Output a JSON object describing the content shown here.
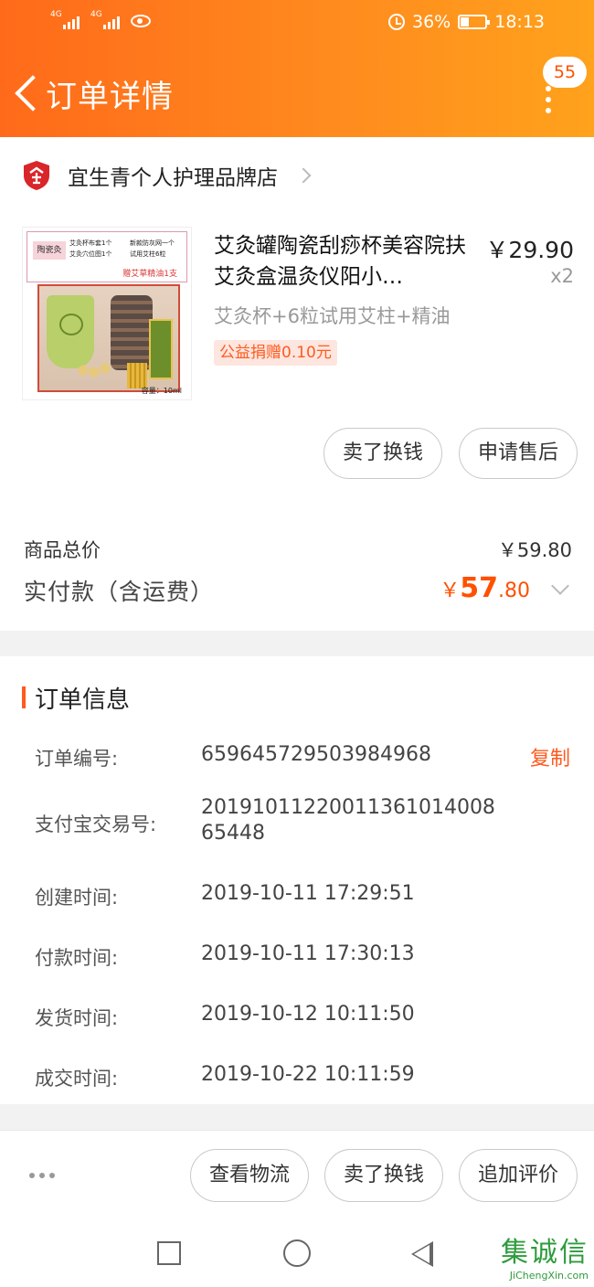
{
  "status": {
    "network_1": "4G",
    "network_2": "4G",
    "battery": "36%",
    "time": "18:13"
  },
  "nav": {
    "title": "订单详情",
    "badge": "55"
  },
  "store": {
    "name": "宜生青个人护理品牌店"
  },
  "product": {
    "thumb_label": "陶瓷灸",
    "thumb_lines": [
      "艾灸杯布套1个",
      "新款防灰网一个",
      "艾灸穴位图1个",
      "试用艾柱6粒"
    ],
    "thumb_gift": "赠艾草精油1支",
    "thumb_volume": "容量：10ml",
    "name": "艾灸罐陶瓷刮痧杯美容院扶艾灸盒温灸仪阳小…",
    "price": "￥29.90",
    "qty": "x2",
    "sku": "艾灸杯+6粒试用艾柱+精油",
    "donation": "公益捐赠0.10元"
  },
  "item_actions": {
    "sell": "卖了换钱",
    "after_sale": "申请售后"
  },
  "summary": {
    "goods_label": "商品总价",
    "goods_value": "￥59.80",
    "paid_label": "实付款（含运费）",
    "paid_currency": "￥",
    "paid_int": "57",
    "paid_dec": ".80"
  },
  "order_info": {
    "title": "订单信息",
    "copy": "复制",
    "rows": [
      {
        "label": "订单编号:",
        "value": "659645729503984968"
      },
      {
        "label": "支付宝交易号:",
        "value": "2019101122001136101400865448"
      },
      {
        "label": "创建时间:",
        "value": "2019-10-11 17:29:51"
      },
      {
        "label": "付款时间:",
        "value": "2019-10-11 17:30:13"
      },
      {
        "label": "发货时间:",
        "value": "2019-10-12 10:11:50"
      },
      {
        "label": "成交时间:",
        "value": "2019-10-22 10:11:59"
      }
    ]
  },
  "bottom_actions": {
    "logistics": "查看物流",
    "sell": "卖了换钱",
    "review": "追加评价"
  },
  "watermark": {
    "cn": "集诚信",
    "en": "JiChengXin.com"
  }
}
